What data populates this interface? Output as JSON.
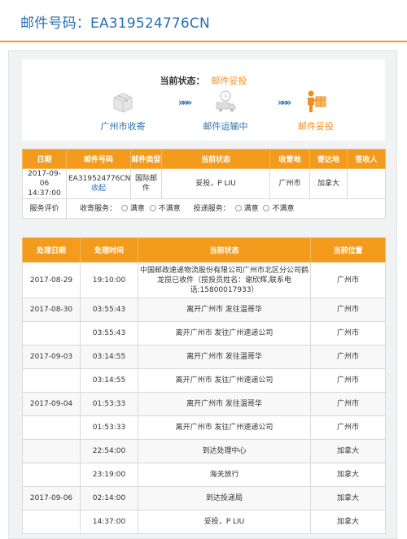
{
  "header": {
    "title": "邮件号码：EA319524776CN"
  },
  "current_status": {
    "label": "当前状态：",
    "value": "邮件妥投"
  },
  "steps": [
    {
      "label": "广州市收寄",
      "icon": "package-box-icon",
      "active": false
    },
    {
      "label": "邮件运输中",
      "icon": "delivery-truck-icon",
      "active": false
    },
    {
      "label": "邮件妥投",
      "icon": "courier-delivered-icon",
      "active": true
    }
  ],
  "arrows": [
    "»»»",
    "»»»"
  ],
  "summary_table": {
    "headers": [
      "日期",
      "邮件号码",
      "邮件类型",
      "当前状态",
      "收寄地",
      "寄达地",
      "签收人"
    ],
    "row": {
      "date": "2017-09-06 14:37:00",
      "mail_no": "EA319524776CN",
      "collapse": "收起",
      "type": "国际邮件",
      "status": "妥投，P LIU",
      "origin": "广州市",
      "destination": "加拿大",
      "signer": ""
    },
    "rating": {
      "label": "服务评价",
      "collect_label": "收寄服务：",
      "deliver_label": "投递服务：",
      "satisfied": "满意",
      "unsatisfied": "不满意"
    }
  },
  "track_table": {
    "headers": [
      "处理日期",
      "处理时间",
      "当前状态",
      "当前位置"
    ],
    "rows": [
      {
        "date": "2017-08-29",
        "time": "19:10:00",
        "status": "中国邮政速递物流股份有限公司广州市北区分公司鹤龙揽已收件（揽投员姓名：谢欣辉,联系电话:15800017933）",
        "location": "广州市"
      },
      {
        "date": "2017-08-30",
        "time": "03:55:43",
        "status": "离开广州市 发往温哥华",
        "location": "广州市"
      },
      {
        "date": "",
        "time": "03:55:43",
        "status": "离开广州市 发往广州速递公司",
        "location": "广州市"
      },
      {
        "date": "2017-09-03",
        "time": "03:14:55",
        "status": "离开广州市 发往温哥华",
        "location": "广州市"
      },
      {
        "date": "",
        "time": "03:14:55",
        "status": "离开广州市 发往广州速递公司",
        "location": "广州市"
      },
      {
        "date": "2017-09-04",
        "time": "01:53:33",
        "status": "离开广州市 发往温哥华",
        "location": "广州市"
      },
      {
        "date": "",
        "time": "01:53:33",
        "status": "离开广州市 发往广州速递公司",
        "location": "广州市"
      },
      {
        "date": "",
        "time": "22:54:00",
        "status": "到达处理中心",
        "location": "加拿大"
      },
      {
        "date": "",
        "time": "23:19:00",
        "status": "海关放行",
        "location": "加拿大"
      },
      {
        "date": "2017-09-06",
        "time": "02:14:00",
        "status": "到达投递局",
        "location": "加拿大"
      },
      {
        "date": "",
        "time": "14:37:00",
        "status": "妥投，P LIU",
        "location": "加拿大"
      }
    ]
  },
  "colors": {
    "accent_orange": "#f39b1c",
    "link_blue": "#2a6fb0"
  }
}
